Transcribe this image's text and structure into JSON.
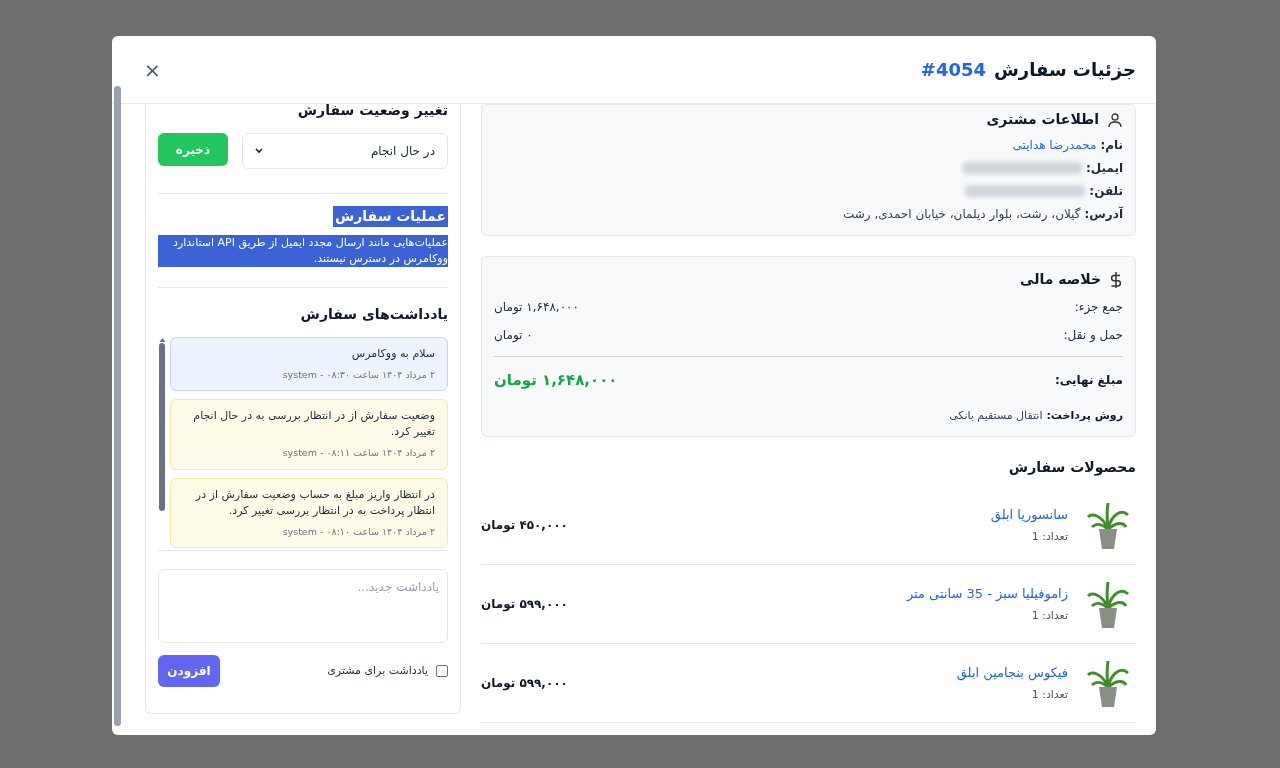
{
  "dialog": {
    "title": "جزئیات سفارش",
    "order_number": "#4054",
    "close": "×"
  },
  "customer": {
    "title": "اطلاعات مشتری",
    "fields": [
      {
        "kind": "link",
        "label": "نام:",
        "value": "محمدرضا هدایتی"
      },
      {
        "kind": "redacted",
        "label": "ایمیل:"
      },
      {
        "kind": "redacted",
        "label": "تلفن:"
      },
      {
        "kind": "text",
        "label": "آدرس:",
        "value": "گیلان، رشت، بلوار دیلمان، خیابان احمدی, رشت"
      }
    ]
  },
  "finance": {
    "title": "خلاصه مالی",
    "rows": [
      {
        "label": "جمع جزء:",
        "value": "۱,۶۴۸,۰۰۰ تومان"
      },
      {
        "label": "حمل و نقل:",
        "value": "۰ تومان"
      }
    ],
    "total": {
      "label": "مبلغ نهایی:",
      "value": "۱,۶۴۸,۰۰۰ تومان"
    },
    "payment": {
      "label": "روش پرداخت:",
      "value": "انتقال مستقیم بانکی"
    }
  },
  "products": {
    "title": "محصولات سفارش",
    "items": [
      {
        "name": "سانسوریا ابلق",
        "qty": "تعداد: 1",
        "price": "۴۵۰,۰۰۰ تومان"
      },
      {
        "name": "زاموفیلیا سبز - 35 سانتی متر",
        "qty": "تعداد: 1",
        "price": "۵۹۹,۰۰۰ تومان"
      },
      {
        "name": "فیکوس بنجامین ابلق",
        "qty": "تعداد: 1",
        "price": "۵۹۹,۰۰۰ تومان"
      }
    ]
  },
  "status": {
    "title": "تغییر وضعیت سفارش",
    "value": "در حال انجام",
    "save": "ذخیره"
  },
  "operations": {
    "title": "عملیات سفارش",
    "text": "عملیات‌هایی مانند ارسال مجدد ایمیل از طریق API استاندارد ووکامرس در دسترس نیستند.",
    "highlighted": true
  },
  "notes": {
    "title": "یادداشت‌های سفارش",
    "items": [
      {
        "kind": "private",
        "text": "سلام به ووکامرس",
        "meta": "۲ مرداد ۱۴۰۴ ساعت ۰۸:۳۰ - system"
      },
      {
        "kind": "system",
        "text": "وضعیت سفارش از در انتظار بررسی به در حال انجام تغییر کرد.",
        "meta": "۲ مرداد ۱۴۰۴ ساعت ۰۸:۱۱ - system"
      },
      {
        "kind": "system",
        "text": "در انتظار واریز مبلغ به حساب وضعیت سفارش از در انتظار پرداخت به در انتظار بررسی تغییر کرد.",
        "meta": "۲ مرداد ۱۴۰۴ ساعت ۰۸:۱۰ - system"
      }
    ],
    "placeholder": "یادداشت جدید...",
    "customer_note": {
      "label": "یادداشت برای مشتری",
      "checked": false
    },
    "add": "افزودن"
  }
}
